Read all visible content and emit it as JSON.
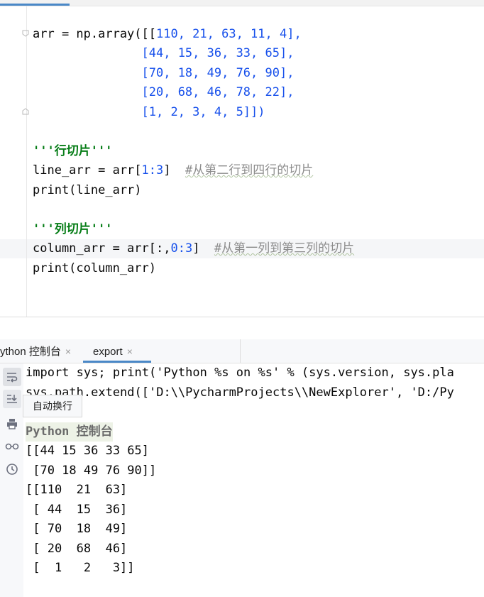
{
  "editor": {
    "code_lines": [
      {
        "plain": "arr = np.array([["
      },
      {
        "plain": "               [44, 15, 36, 33, 65],"
      },
      {
        "plain": "               [70, 18, 49, 76, 90],"
      },
      {
        "plain": "               [20, 68, 46, 78, 22],"
      },
      {
        "plain": "               [1, 2, 3, 4, 5]])"
      }
    ],
    "line1_rest": "110, 21, 63, 11, 4],",
    "row_docstring_1": "'''行切片'''",
    "line_arr_code": "line_arr = arr[",
    "line_arr_slice": "1:3",
    "line_arr_close": "]  ",
    "line_arr_comment": "#从第二行到四行的切片",
    "print_line_arr": "print(line_arr)",
    "row_docstring_2": "'''列切片'''",
    "column_arr_code": "column_arr = arr[:,",
    "column_arr_slice": "0:3",
    "column_arr_close": "]  ",
    "column_arr_comment": "#从第一列到第三列的切片",
    "print_column_arr": "print(column_arr)"
  },
  "run_panel": {
    "tabs": [
      {
        "label": "ython 控制台",
        "close": "×"
      },
      {
        "label": "export",
        "close": "×"
      }
    ],
    "tooltip": "自动换行",
    "toolbar_icons": [
      "soft-wrap-icon",
      "scroll-to-end-icon",
      "print-icon",
      "glasses-icon",
      "clock-icon"
    ],
    "console_lines": [
      "import sys; print('Python %s on %s' % (sys.version, sys.pla",
      "sys.path.extend(['D:\\\\PycharmProjects\\\\NewExplorer', 'D:/Py",
      "Python 控制台",
      "[[44 15 36 33 65]",
      " [70 18 49 76 90]]",
      "[[110  21  63]",
      " [ 44  15  36]",
      " [ 70  18  49]",
      " [ 20  68  46]",
      " [  1   2   3]]"
    ]
  },
  "colors": {
    "accent": "#4a88c7",
    "number": "#1750eb",
    "docstring": "#067d17",
    "comment": "#8c8c8c"
  }
}
